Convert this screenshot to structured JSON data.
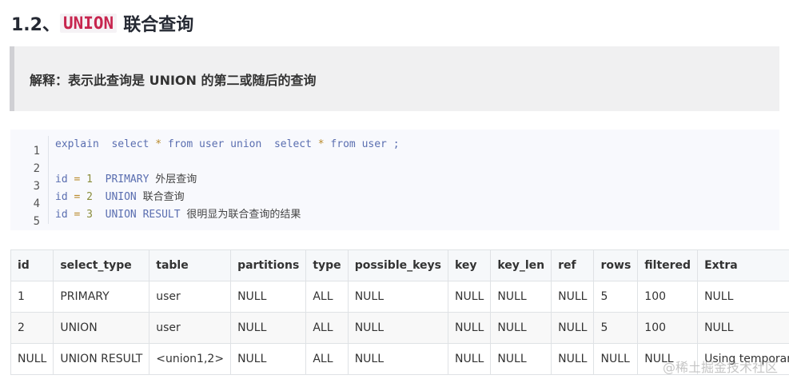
{
  "heading": {
    "prefix": "1.2、",
    "code": "UNION",
    "suffix": "联合查询"
  },
  "explanation": "解释：表示此查询是 UNION 的第二或随后的查询",
  "code": {
    "lines": [
      {
        "n": "1"
      },
      {
        "n": "2"
      },
      {
        "n": "3"
      },
      {
        "n": "4"
      },
      {
        "n": "5"
      }
    ],
    "l1": {
      "a": "explain",
      "b": "select",
      "c": "*",
      "d": "from user union",
      "e": "select",
      "f": "*",
      "g": "from",
      "h": "user ;"
    },
    "l3": {
      "a": "id",
      "b": "=",
      "c": "1",
      "d": "PRIMARY",
      "e": "外层查询"
    },
    "l4": {
      "a": "id",
      "b": "=",
      "c": "2",
      "d": "UNION",
      "e": "联合查询"
    },
    "l5": {
      "a": "id",
      "b": "=",
      "c": "3",
      "d": "UNION RESULT",
      "e": "很明显为联合查询的结果"
    }
  },
  "table": {
    "headers": [
      "id",
      "select_type",
      "table",
      "partitions",
      "type",
      "possible_keys",
      "key",
      "key_len",
      "ref",
      "rows",
      "filtered",
      "Extra"
    ],
    "rows": [
      [
        "1",
        "PRIMARY",
        "user",
        "NULL",
        "ALL",
        "NULL",
        "NULL",
        "NULL",
        "NULL",
        "5",
        "100",
        "NULL"
      ],
      [
        "2",
        "UNION",
        "user",
        "NULL",
        "ALL",
        "NULL",
        "NULL",
        "NULL",
        "NULL",
        "5",
        "100",
        "NULL"
      ],
      [
        "NULL",
        "UNION RESULT",
        "<union1,2>",
        "NULL",
        "ALL",
        "NULL",
        "NULL",
        "NULL",
        "NULL",
        "NULL",
        "NULL",
        "Using temporary"
      ]
    ]
  },
  "watermark": "@稀土掘金技术社区"
}
